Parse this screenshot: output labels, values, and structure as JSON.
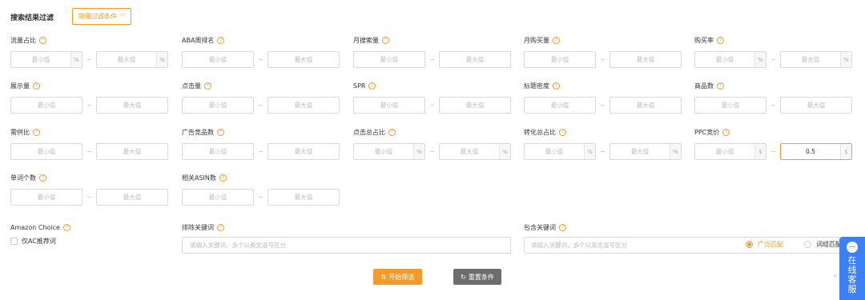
{
  "header": {
    "title": "搜索结果过滤",
    "toggle_label": "隐藏过滤条件"
  },
  "common": {
    "min_placeholder": "最小值",
    "max_placeholder": "最大值",
    "percent_suffix": "%",
    "dollar_suffix": "$",
    "dash": "~"
  },
  "fields": [
    {
      "label": "流量占比",
      "suffix": "%"
    },
    {
      "label": "ABA周排名",
      "suffix": ""
    },
    {
      "label": "月搜索量",
      "suffix": ""
    },
    {
      "label": "月购买量",
      "suffix": ""
    },
    {
      "label": "购买率",
      "suffix": "%"
    },
    {
      "label": "展示量",
      "suffix": ""
    },
    {
      "label": "点击量",
      "suffix": ""
    },
    {
      "label": "SPR",
      "suffix": ""
    },
    {
      "label": "标题密度",
      "suffix": ""
    },
    {
      "label": "商品数",
      "suffix": ""
    },
    {
      "label": "需供比",
      "suffix": ""
    },
    {
      "label": "广告竞品数",
      "suffix": ""
    },
    {
      "label": "点击总占比",
      "suffix": "%"
    },
    {
      "label": "转化总占比",
      "suffix": "%"
    },
    {
      "label": "PPC竞价",
      "suffix": "$",
      "max_value": "0.5"
    },
    {
      "label": "单词个数",
      "suffix": ""
    },
    {
      "label": "相关ASIN数",
      "suffix": ""
    }
  ],
  "amazon_choice": {
    "label": "Amazon Choice",
    "checkbox_label": "仅AC推荐词"
  },
  "exclude_keywords": {
    "label": "排除关键词",
    "placeholder": "请输入关键词，多个以英文逗号区分"
  },
  "include_keywords": {
    "label": "包含关键词",
    "placeholder": "请输入关键词，多个以英文逗号区分",
    "match_options": [
      "广泛匹配",
      "词组匹配"
    ],
    "selected": "广泛匹配"
  },
  "actions": {
    "start_label": "开始筛选",
    "reset_label": "重置条件"
  },
  "support_widget": {
    "text": "在线客服"
  },
  "colors": {
    "accent": "#f39a2b",
    "reset_button": "#6d6d6d",
    "support_blue": "#3d7ff5"
  }
}
